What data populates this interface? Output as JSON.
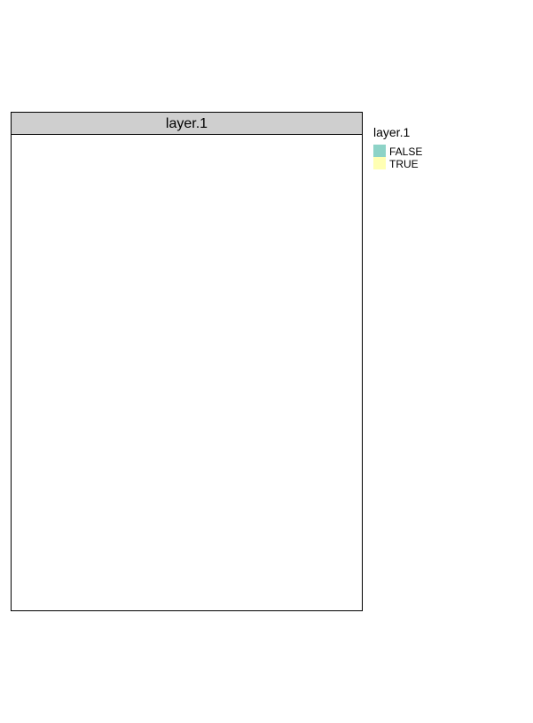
{
  "chart_data": {
    "type": "heatmap",
    "title": "",
    "panels": [
      {
        "label": "layer.1",
        "cells": []
      }
    ],
    "legend": {
      "title": "layer.1",
      "placement": "right",
      "entries": [
        {
          "label": "FALSE",
          "color": "#8dd3c7"
        },
        {
          "label": "TRUE",
          "color": "#ffffb3"
        }
      ]
    },
    "grid": false
  }
}
